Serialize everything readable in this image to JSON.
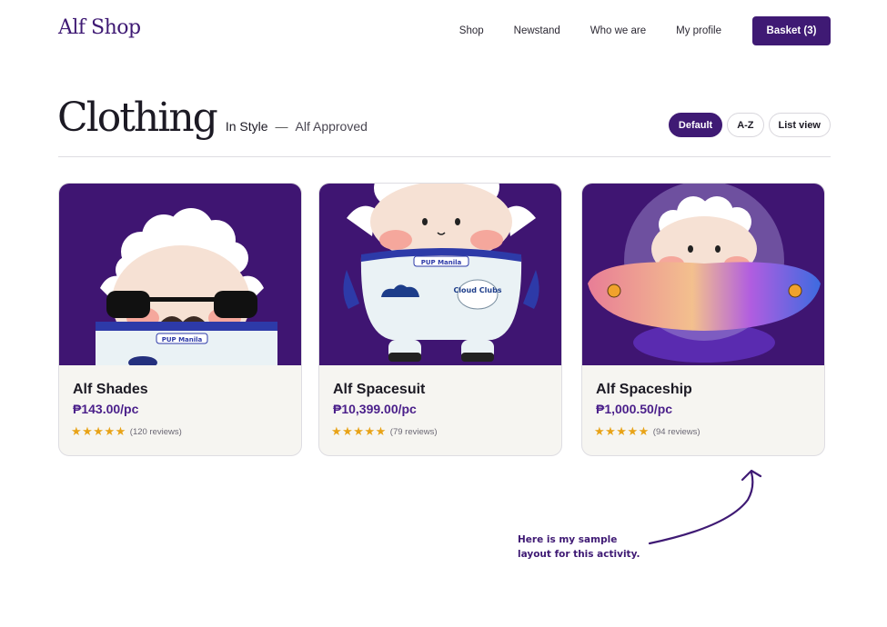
{
  "header": {
    "brand": "Alf Shop",
    "nav": [
      "Shop",
      "Newstand",
      "Who we are",
      "My profile"
    ],
    "basket_label": "Basket (3)"
  },
  "page": {
    "title": "Clothing",
    "subtitle_primary": "In Style",
    "separator": "—",
    "subtitle_secondary": "Alf Approved"
  },
  "filters": [
    {
      "label": "Default",
      "active": true
    },
    {
      "label": "A-Z",
      "active": false
    },
    {
      "label": "List view",
      "active": false
    }
  ],
  "products": [
    {
      "name": "Alf Shades",
      "price": "₱143.00/pc",
      "stars": "★★★★★",
      "reviews": "(120 reviews)",
      "image": "sheep-with-sunglasses-and-mustache"
    },
    {
      "name": "Alf Spacesuit",
      "price": "₱10,399.00/pc",
      "stars": "★★★★★",
      "reviews": "(79 reviews)",
      "image": "sheep-in-spacesuit"
    },
    {
      "name": "Alf Spaceship",
      "price": "₱1,000.50/pc",
      "stars": "★★★★★",
      "reviews": "(94 reviews)",
      "image": "sheep-in-ufo-spaceship"
    }
  ],
  "badge_text": "PUP Manila",
  "patch_text": "Cloud Clubs",
  "annotation": {
    "line1": "Here is my sample",
    "line2": "layout for this activity."
  },
  "colors": {
    "brand": "#3f1a74",
    "card_image_bg": "#3f1572",
    "star": "#e8a317"
  }
}
